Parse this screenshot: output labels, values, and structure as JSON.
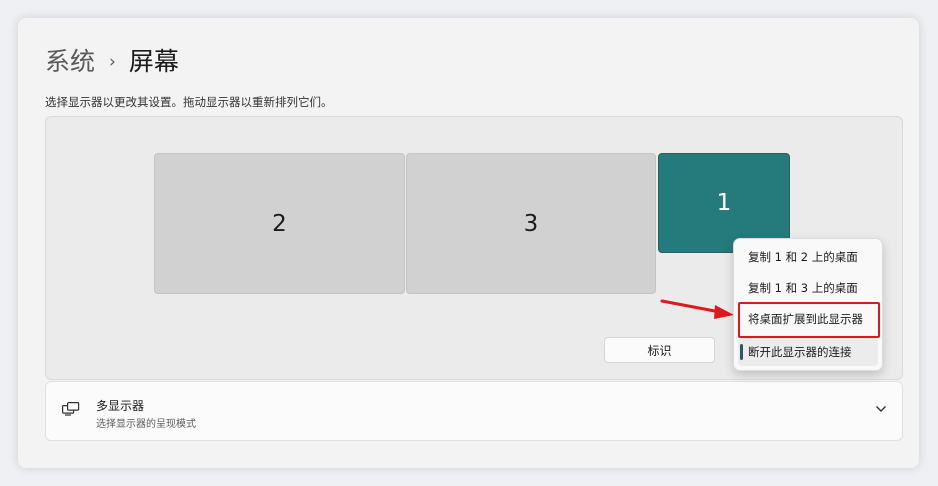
{
  "breadcrumb": {
    "parent": "系统",
    "separator": "›",
    "current": "屏幕"
  },
  "description": "选择显示器以更改其设置。拖动显示器以重新排列它们。",
  "monitors": [
    {
      "label": "2",
      "selected": false
    },
    {
      "label": "3",
      "selected": false
    },
    {
      "label": "1",
      "selected": true
    }
  ],
  "identify_button": "标识",
  "context_menu": {
    "items": [
      "复制 1 和 2 上的桌面",
      "复制 1 和 3 上的桌面",
      "将桌面扩展到此显示器",
      "断开此显示器的连接"
    ],
    "highlighted_index": 2
  },
  "multi_display": {
    "title": "多显示器",
    "subtitle": "选择显示器的呈现模式",
    "icon": "multi-monitor-icon",
    "chevron": "chevron-down-icon"
  },
  "colors": {
    "selected_monitor": "#257a7b",
    "monitor": "#d1d1d1",
    "highlight_annotation": "#e0171c"
  }
}
